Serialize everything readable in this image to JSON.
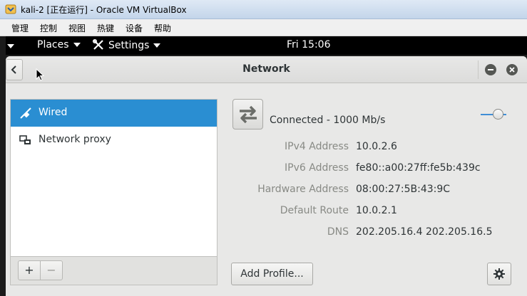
{
  "host_window": {
    "title": "kali-2 [正在运行] - Oracle VM VirtualBox",
    "menu": [
      "管理",
      "控制",
      "视图",
      "热键",
      "设备",
      "帮助"
    ]
  },
  "top_bar": {
    "places_label": "Places",
    "settings_label": "Settings",
    "clock": "Fri 15:06"
  },
  "settings_window": {
    "title": "Network"
  },
  "sidebar": {
    "items": [
      {
        "label": "Wired",
        "icon": "wired-network-icon",
        "selected": true
      },
      {
        "label": "Network proxy",
        "icon": "network-proxy-icon",
        "selected": false
      }
    ],
    "add_label": "+",
    "remove_label": "−"
  },
  "connection": {
    "status": "Connected - 1000 Mb/s",
    "switch_on": true,
    "details": [
      {
        "label": "IPv4 Address",
        "value": "10.0.2.6"
      },
      {
        "label": "IPv6 Address",
        "value": "fe80::a00:27ff:fe5b:439c"
      },
      {
        "label": "Hardware Address",
        "value": "08:00:27:5B:43:9C"
      },
      {
        "label": "Default Route",
        "value": "10.0.2.1"
      },
      {
        "label": "DNS",
        "value": "202.205.16.4 202.205.16.5"
      }
    ],
    "add_profile_label": "Add Profile..."
  },
  "colors": {
    "selection": "#2a8ed2",
    "toggle_accent": "#3f8ed6",
    "topbar": "#000000"
  }
}
